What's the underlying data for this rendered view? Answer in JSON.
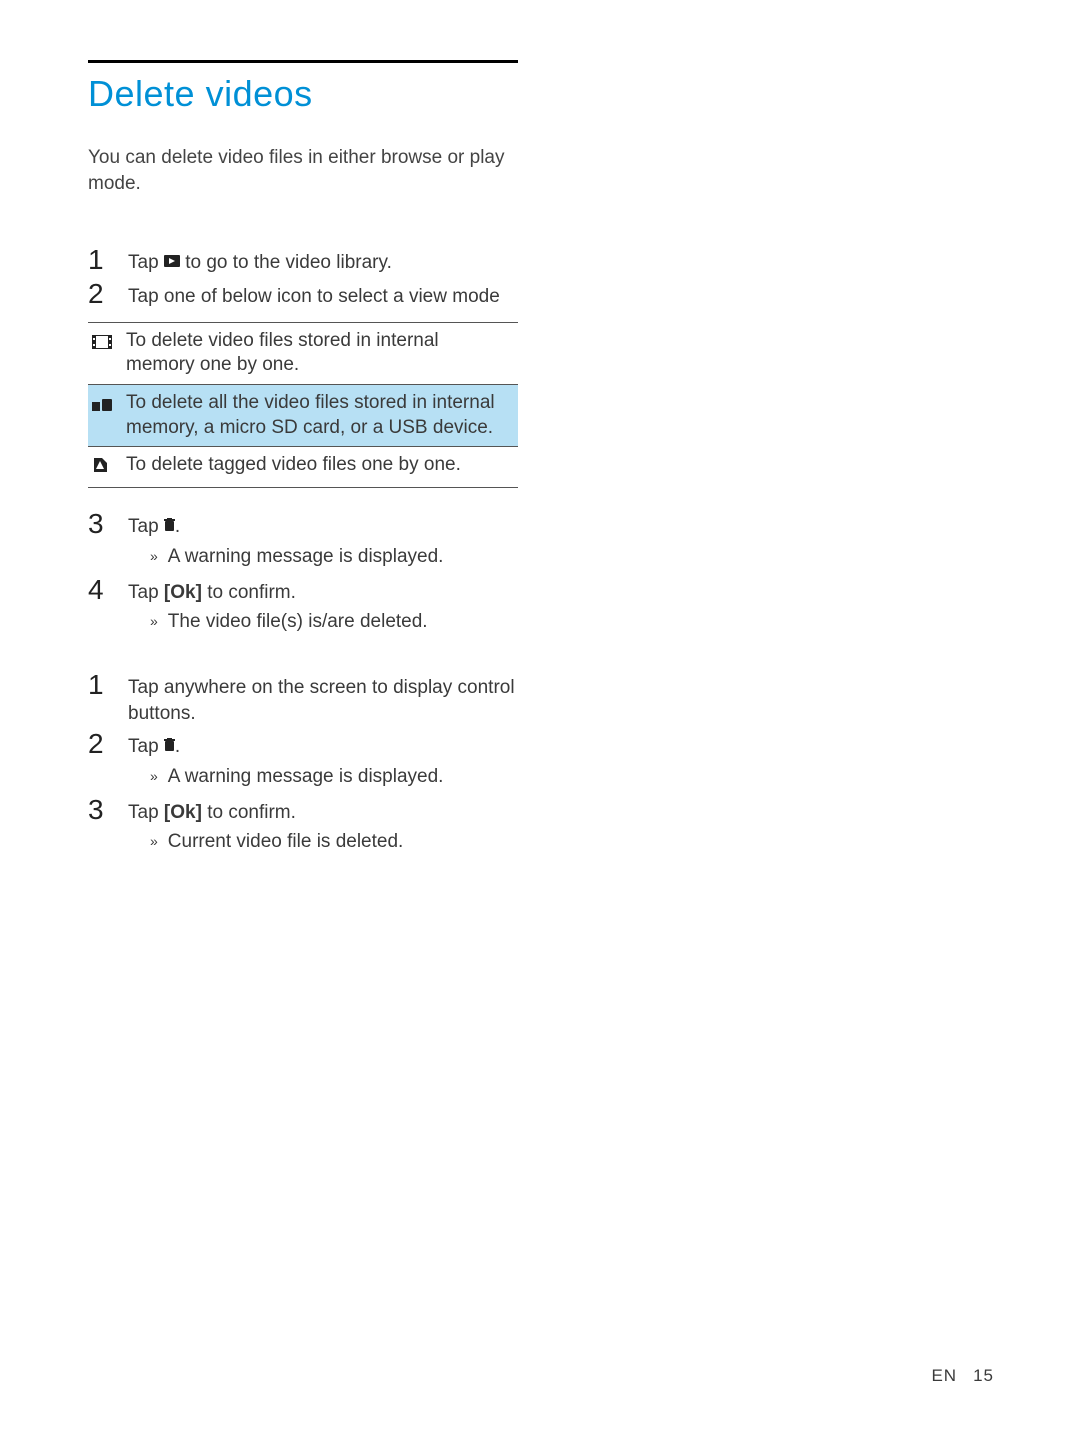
{
  "heading": "Delete videos",
  "intro": "You can delete video files in either browse or play mode.",
  "stepsA": {
    "s1": {
      "n": "1",
      "pre": "Tap ",
      "post": " to go to the video library."
    },
    "s2": {
      "n": "2",
      "text": "Tap one of below icon to select a view mode"
    }
  },
  "table": {
    "r1": "To delete video files stored in internal memory one by one.",
    "r2": "To delete all the video files stored in internal memory, a micro SD card, or a USB device.",
    "r3": "To delete tagged video files one by one."
  },
  "stepsB": {
    "s3": {
      "n": "3",
      "pre": "Tap ",
      "post": "."
    },
    "s3r": "A warning message is displayed.",
    "s4": {
      "n": "4",
      "pre": "Tap ",
      "ok": "[Ok]",
      "post": " to confirm."
    },
    "s4r": "The video file(s) is/are deleted."
  },
  "stepsC": {
    "s1": {
      "n": "1",
      "text": "Tap anywhere on the screen to display control buttons."
    },
    "s2": {
      "n": "2",
      "pre": "Tap ",
      "post": "."
    },
    "s2r": "A warning message is displayed.",
    "s3": {
      "n": "3",
      "pre": "Tap ",
      "ok": "[Ok]",
      "post": " to confirm."
    },
    "s3r": "Current video file is deleted."
  },
  "footer": {
    "lang": "EN",
    "page": "15"
  },
  "chev": "»"
}
